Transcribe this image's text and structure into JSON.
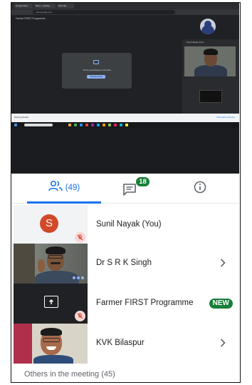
{
  "desktop": {
    "tabs": [
      "Google Meet",
      "Meet - meeting",
      "New tab"
    ],
    "url": "meet.google.com",
    "meeting_title": "Farmer FIRST Programme",
    "present_prompt": "You're presenting to everyone",
    "present_button": "Stop presenting",
    "side_label": "Sunil Nayak (You)",
    "bottom_left": "Meeting details",
    "bottom_right": "Chat with everyone"
  },
  "tabs": {
    "people_count": "(49)",
    "chat_badge": "18"
  },
  "participants": [
    {
      "name": "Sunil Nayak (You)",
      "avatar_letter": "S",
      "muted": true
    },
    {
      "name": "Dr S R K Singh",
      "muted": false,
      "speaking": true
    },
    {
      "name": "Farmer FIRST Programme",
      "badge": "NEW",
      "muted": true,
      "presenting": true
    },
    {
      "name": "KVK Bilaspur",
      "muted": false
    }
  ],
  "others_label": "Others in the meeting (45)",
  "colors": {
    "accent": "#1a73e8",
    "badge_green": "#188038",
    "avatar_red": "#d2492a",
    "mute_red": "#d93025"
  }
}
